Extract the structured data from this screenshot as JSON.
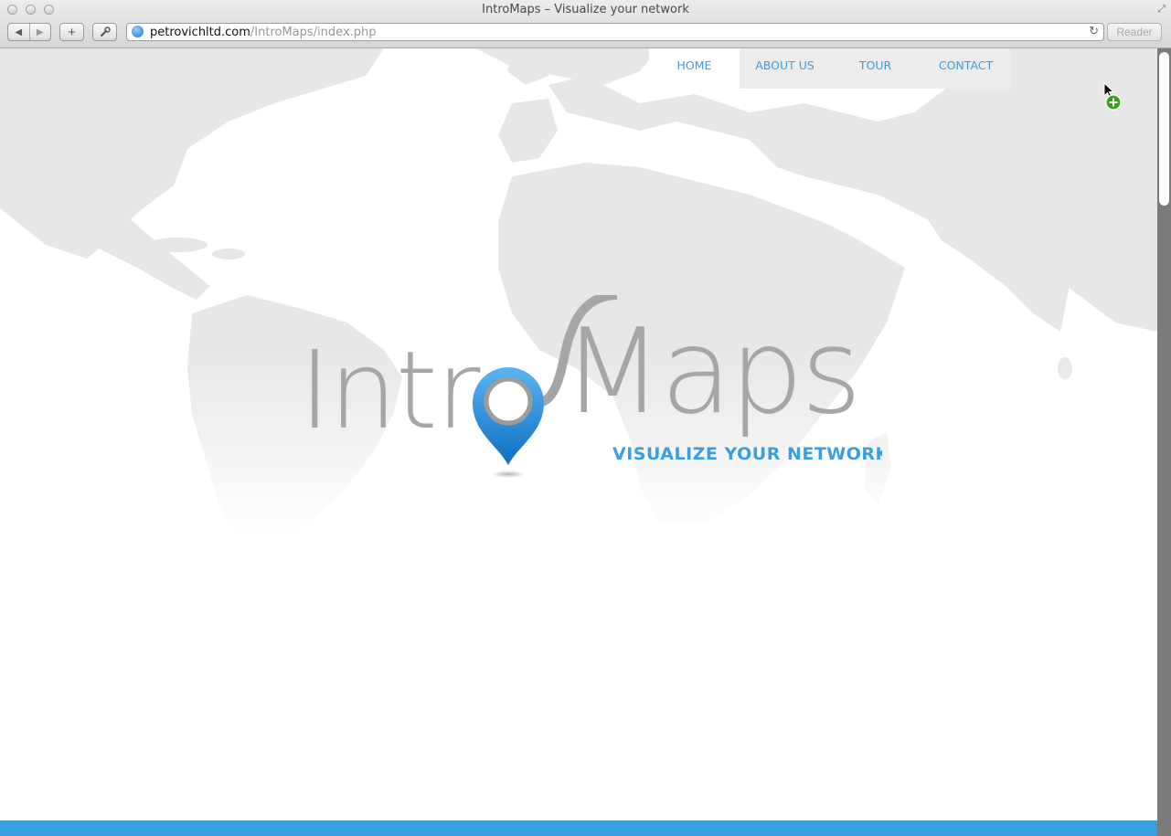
{
  "browser": {
    "window_title": "IntroMaps – Visualize your network",
    "back_icon": "back-arrow-icon",
    "forward_icon": "forward-arrow-icon",
    "add_icon": "plus-icon",
    "wrench_icon": "wrench-icon",
    "url_host": "petrovichltd.com",
    "url_path": "/IntroMaps/index.php",
    "reader_label": "Reader"
  },
  "nav": {
    "items": [
      {
        "label": "HOME",
        "active": true
      },
      {
        "label": "ABOUT US",
        "active": false
      },
      {
        "label": "TOUR",
        "active": false
      },
      {
        "label": "CONTACT",
        "active": false
      }
    ]
  },
  "logo": {
    "word_left": "Intr",
    "word_right": "Maps",
    "tagline": "VISUALIZE YOUR NETWORK"
  },
  "colors": {
    "accent": "#3a9fe0",
    "logo_gray": "#a6a6a6",
    "map": "#e6e6e6",
    "nav_bg": "#ececec"
  }
}
